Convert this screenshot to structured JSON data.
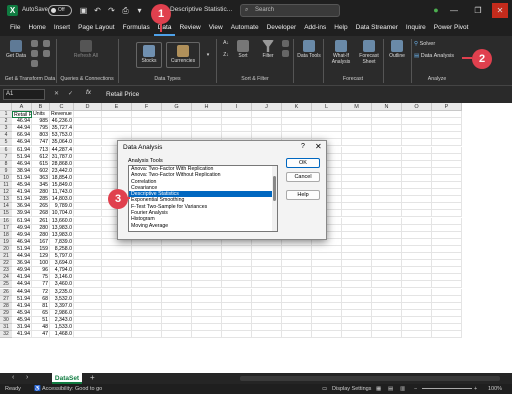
{
  "titlebar": {
    "autosave_label": "AutoSave",
    "autosave_state": "Off",
    "doc_title": "Descriptive Statistic...",
    "search_placeholder": "Search",
    "feedback_icon": "feedback-icon",
    "minimize_icon": "minimize-icon",
    "restore_icon": "restore-icon",
    "close_icon": "close-icon"
  },
  "tabs": [
    "File",
    "Home",
    "Insert",
    "Page Layout",
    "Formulas",
    "Data",
    "Review",
    "View",
    "Automate",
    "Developer",
    "Add-ins",
    "Help",
    "Data Streamer",
    "Inquire",
    "Power Pivot"
  ],
  "active_tab": "Data",
  "ribbon": {
    "get_data": "Get Data",
    "refresh_all": "Refresh All",
    "stocks": "Stocks",
    "currencies": "Currencies",
    "sort": "Sort",
    "filter": "Filter",
    "data_tools": "Data Tools",
    "what_if": "What-If Analysis",
    "forecast_sheet": "Forecast Sheet",
    "outline": "Outline",
    "solver": "Solver",
    "data_analysis": "Data Analysis",
    "groups": {
      "get_transform": "Get & Transform Data",
      "queries": "Queries & Connections",
      "data_types": "Data Types",
      "sort_filter": "Sort & Filter",
      "forecast": "Forecast",
      "analyze": "Analyze"
    }
  },
  "formula_bar": {
    "name_box": "A1",
    "fx": "fx",
    "formula": "Retail Price"
  },
  "columns": [
    "A",
    "B",
    "C",
    "D",
    "E",
    "F",
    "G",
    "H",
    "I",
    "J",
    "K",
    "L",
    "M",
    "N",
    "O",
    "P"
  ],
  "headers": [
    "Retail Price",
    "Units",
    "Revenue"
  ],
  "rows": [
    [
      "46.94",
      "985",
      "46,236.0"
    ],
    [
      "44.94",
      "795",
      "35,727.4"
    ],
    [
      "66.94",
      "803",
      "53,753.0"
    ],
    [
      "46.94",
      "747",
      "35,064.0"
    ],
    [
      "61.94",
      "713",
      "44,287.4"
    ],
    [
      "51.94",
      "612",
      "31,787.0"
    ],
    [
      "46.94",
      "615",
      "28,868.0"
    ],
    [
      "38.94",
      "602",
      "23,442.0"
    ],
    [
      "51.94",
      "363",
      "18,854.0"
    ],
    [
      "45.94",
      "345",
      "15,849.0"
    ],
    [
      "41.94",
      "280",
      "11,743.0"
    ],
    [
      "51.94",
      "285",
      "14,803.0"
    ],
    [
      "36.94",
      "265",
      "9,789.0"
    ],
    [
      "39.94",
      "268",
      "10,704.0"
    ],
    [
      "61.94",
      "261",
      "13,660.0"
    ],
    [
      "49.94",
      "280",
      "13,983.0"
    ],
    [
      "49.94",
      "280",
      "13,983.0"
    ],
    [
      "46.94",
      "167",
      "7,839.0"
    ],
    [
      "51.94",
      "159",
      "8,258.0"
    ],
    [
      "44.94",
      "129",
      "5,797.0"
    ],
    [
      "36.94",
      "100",
      "3,694.0"
    ],
    [
      "49.94",
      "96",
      "4,794.0"
    ],
    [
      "41.94",
      "75",
      "3,146.0"
    ],
    [
      "44.94",
      "77",
      "3,460.0"
    ],
    [
      "44.94",
      "72",
      "3,235.0"
    ],
    [
      "51.94",
      "68",
      "3,532.0"
    ],
    [
      "41.94",
      "81",
      "3,397.0"
    ],
    [
      "45.94",
      "65",
      "2,986.0"
    ],
    [
      "45.94",
      "51",
      "2,343.0"
    ],
    [
      "31.94",
      "48",
      "1,533.0"
    ],
    [
      "41.94",
      "47",
      "1,468.0"
    ]
  ],
  "dialog": {
    "title": "Data Analysis",
    "help_glyph": "?",
    "close_glyph": "✕",
    "tools_label": "Analysis Tools",
    "tools": [
      "Anova: Two-Factor With Replication",
      "Anova: Two-Factor Without Replication",
      "Correlation",
      "Covariance",
      "Descriptive Statistics",
      "Exponential Smoothing",
      "F-Test Two-Sample for Variances",
      "Fourier Analysis",
      "Histogram",
      "Moving Average"
    ],
    "selected": "Descriptive Statistics",
    "ok": "OK",
    "cancel": "Cancel",
    "help": "Help"
  },
  "callouts": [
    "1",
    "2",
    "3"
  ],
  "sheet": {
    "tab": "DataSet",
    "add": "+"
  },
  "status": {
    "ready": "Ready",
    "accessibility": "Accessibility: Good to go",
    "display_settings": "Display Settings",
    "zoom": "100%"
  },
  "colors": {
    "accent": "#107c41",
    "callout": "#e0404e",
    "selection": "#0067c0"
  }
}
